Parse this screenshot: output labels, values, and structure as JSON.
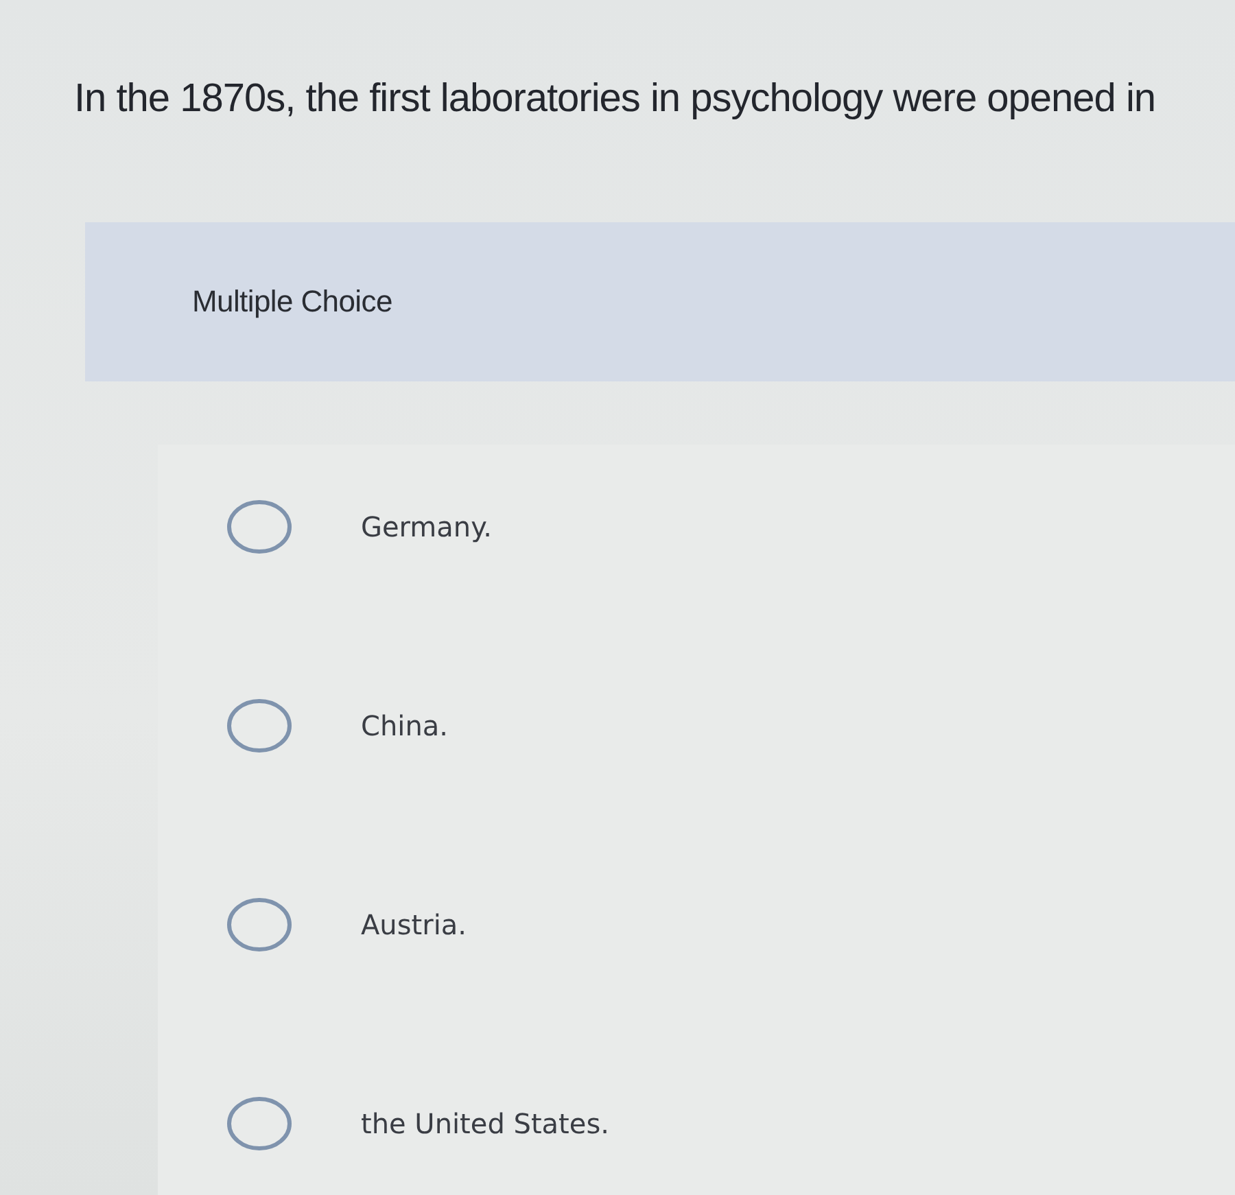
{
  "question": {
    "text": "In the 1870s, the first laboratories in psychology were opened in"
  },
  "section": {
    "label": "Multiple Choice"
  },
  "options": [
    {
      "label": "Germany.",
      "selected": false
    },
    {
      "label": "China.",
      "selected": false
    },
    {
      "label": "Austria.",
      "selected": false
    },
    {
      "label": "the United States.",
      "selected": false
    }
  ]
}
